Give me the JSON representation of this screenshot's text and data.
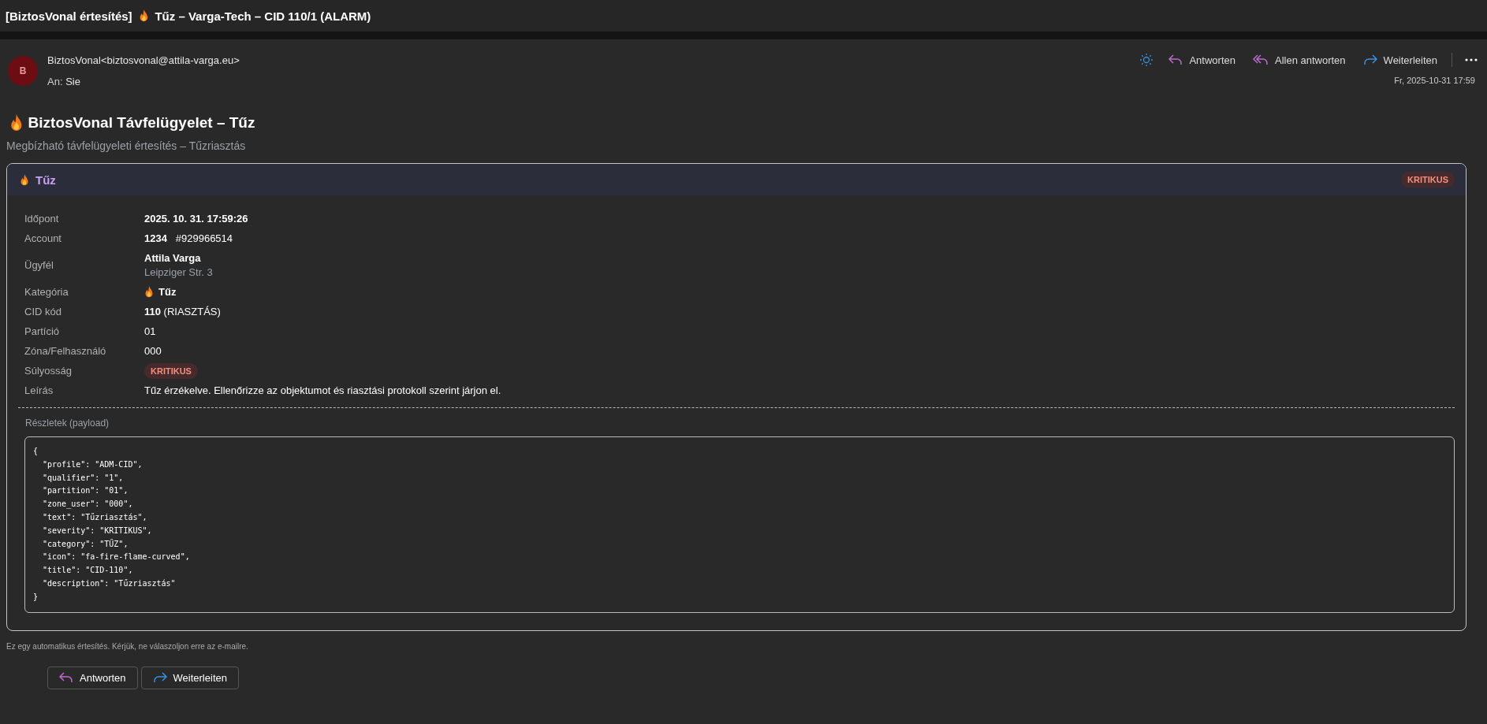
{
  "window": {
    "title": "[BiztosVonal értesítés]",
    "title_rest": "Tűz – Varga-Tech – CID 110/1 (ALARM)"
  },
  "message": {
    "avatar": "B",
    "sender": "BiztosVonal<biztosvonal@attila-varga.eu>",
    "to_label": "An:",
    "to": "Sie",
    "date": "Fr, 2025-10-31 17:59",
    "actions": [
      {
        "kind": "reply",
        "label": "Antworten"
      },
      {
        "kind": "reply_all",
        "label": "Allen antworten"
      },
      {
        "kind": "forward",
        "label": "Weiterleiten"
      }
    ]
  },
  "heading": "BiztosVonal Távfelügyelet – Tűz",
  "subheading": "Megbízható távfelügyeleti értesítés – Tűzriasztás",
  "card": {
    "title": "Tűz",
    "badge": "KRITIKUS",
    "rows": [
      {
        "kind": "text",
        "label": "Időpont",
        "value": "2025. 10. 31. 17:59:26",
        "bold": true
      },
      {
        "kind": "text",
        "label": "Account",
        "value": "**1234**   #929966514",
        "bold": false
      },
      {
        "kind": "client",
        "label": "Ügyfél",
        "value": "Attila Varga",
        "sub": "Leipziger Str. 3"
      },
      {
        "kind": "category",
        "label": "Kategória",
        "value": "Tűz"
      },
      {
        "kind": "text",
        "label": "CID kód",
        "value": "**110** (RIASZTÁS)",
        "bold": false
      },
      {
        "kind": "text",
        "label": "Partíció",
        "value": "01",
        "bold": false
      },
      {
        "kind": "text",
        "label": "Zóna/Felhasználó",
        "value": "000",
        "bold": false
      },
      {
        "kind": "badge",
        "label": "Súlyosság",
        "value": "KRITIKUS"
      },
      {
        "kind": "text",
        "label": "Leírás",
        "value": "Tűz érzékelve. Ellenőrizze az objektumot és riasztási protokoll szerint járjon el.",
        "bold": false
      }
    ],
    "payload_label": "Részletek (payload)",
    "payload": "{\n  \"profile\": \"ADM-CID\",\n  \"qualifier\": \"1\",\n  \"partition\": \"01\",\n  \"zone_user\": \"000\",\n  \"text\": \"Tűzriasztás\",\n  \"severity\": \"KRITIKUS\",\n  \"category\": \"TŰZ\",\n  \"icon\": \"fa-fire-flame-curved\",\n  \"title\": \"CID-110\",\n  \"description\": \"Tűzriasztás\"\n}"
  },
  "footer": "Ez egy automatikus értesítés. Kérjük, ne válaszoljon erre az e-mailre.",
  "bottom_actions": [
    {
      "kind": "reply",
      "label": "Antworten"
    },
    {
      "kind": "forward",
      "label": "Weiterleiten"
    }
  ]
}
